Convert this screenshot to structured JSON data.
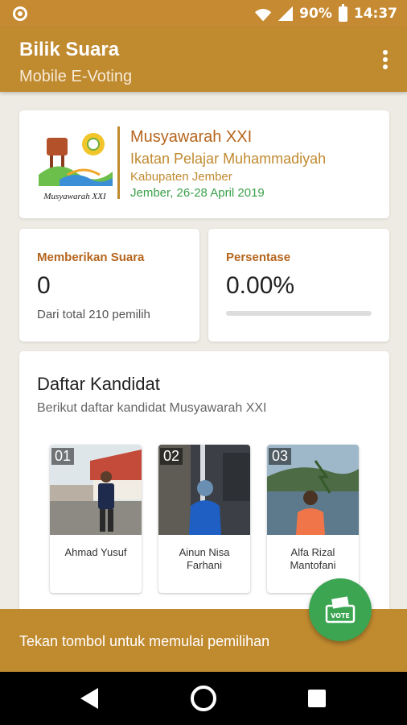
{
  "status": {
    "battery_pct": "90%",
    "time": "14:37"
  },
  "appbar": {
    "title": "Bilik Suara",
    "subtitle": "Mobile E-Voting"
  },
  "event": {
    "logo_text": "Musyawarah XXI",
    "name": "Musyawarah XXI",
    "organization": "Ikatan Pelajar Muhammadiyah",
    "region": "Kabupaten Jember",
    "date": "Jember, 26-28 April 2019"
  },
  "stats": {
    "votes_label": "Memberikan Suara",
    "votes_value": "0",
    "votes_sub": "Dari total 210 pemilih",
    "percent_label": "Persentase",
    "percent_value": "0.00%",
    "percent_fraction": 0.0
  },
  "candidates": {
    "title": "Daftar Kandidat",
    "subtitle": "Berikut daftar kandidat Musyawarah XXI",
    "items": [
      {
        "number": "01",
        "name": "Ahmad Yusuf"
      },
      {
        "number": "02",
        "name": "Ainun Nisa Farhani"
      },
      {
        "number": "03",
        "name": "Alfa Rizal Mantofani"
      }
    ]
  },
  "bottom": {
    "prompt": "Tekan tombol untuk memulai pemilihan",
    "fab_label": "VOTE"
  },
  "colors": {
    "primary": "#c08a2f",
    "accent_green": "#3ba552",
    "title_brown": "#b5651d"
  }
}
